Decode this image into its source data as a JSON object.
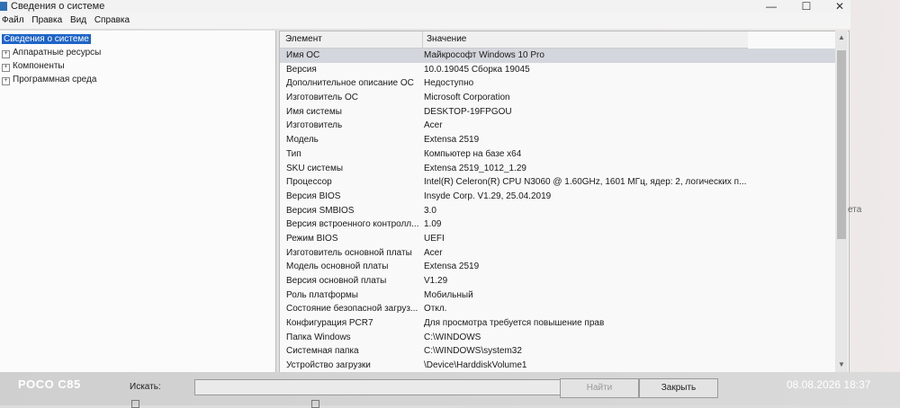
{
  "window": {
    "title": "Сведения о системе",
    "controls": {
      "minimize": "—",
      "maximize": "☐",
      "close": "✕"
    }
  },
  "menu": [
    "Файл",
    "Правка",
    "Вид",
    "Справка"
  ],
  "tree": {
    "root": "Сведения о системе",
    "children": [
      "Аппаратные ресурсы",
      "Компоненты",
      "Программная среда"
    ],
    "expand_symbol": "+"
  },
  "table": {
    "headers": [
      "Элемент",
      "Значение"
    ],
    "rows": [
      {
        "k": "Имя ОС",
        "v": "Майкрософт Windows 10 Pro"
      },
      {
        "k": "Версия",
        "v": "10.0.19045 Сборка 19045"
      },
      {
        "k": "Дополнительное описание ОС",
        "v": "Недоступно"
      },
      {
        "k": "Изготовитель ОС",
        "v": "Microsoft Corporation"
      },
      {
        "k": "Имя системы",
        "v": "DESKTOP-19FPGOU"
      },
      {
        "k": "Изготовитель",
        "v": "Acer"
      },
      {
        "k": "Модель",
        "v": "Extensa 2519"
      },
      {
        "k": "Тип",
        "v": "Компьютер на базе x64"
      },
      {
        "k": "SKU системы",
        "v": "Extensa 2519_1012_1.29"
      },
      {
        "k": "Процессор",
        "v": "Intel(R) Celeron(R) CPU  N3060  @ 1.60GHz, 1601 МГц, ядер: 2, логических п..."
      },
      {
        "k": "Версия BIOS",
        "v": "Insyde Corp. V1.29, 25.04.2019"
      },
      {
        "k": "Версия SMBIOS",
        "v": "3.0"
      },
      {
        "k": "Версия встроенного контролл...",
        "v": "1.09"
      },
      {
        "k": "Режим BIOS",
        "v": "UEFI"
      },
      {
        "k": "Изготовитель основной платы",
        "v": "Acer"
      },
      {
        "k": "Модель основной платы",
        "v": "Extensa 2519"
      },
      {
        "k": "Версия основной платы",
        "v": "V1.29"
      },
      {
        "k": "Роль платформы",
        "v": "Мобильный"
      },
      {
        "k": "Состояние безопасной загруз...",
        "v": "Откл."
      },
      {
        "k": "Конфигурация PCR7",
        "v": "Для просмотра требуется повышение прав"
      },
      {
        "k": "Папка Windows",
        "v": "C:\\WINDOWS"
      },
      {
        "k": "Системная папка",
        "v": "C:\\WINDOWS\\system32"
      },
      {
        "k": "Устройство загрузки",
        "v": "\\Device\\HarddiskVolume1"
      }
    ]
  },
  "side_text": "ета",
  "search": {
    "label": "Искать:",
    "value": "",
    "find_button": "Найти",
    "close_button": "Закрыть"
  },
  "overlay": {
    "device": "POCO C85",
    "datetime": "08.08.2026  18:37"
  }
}
